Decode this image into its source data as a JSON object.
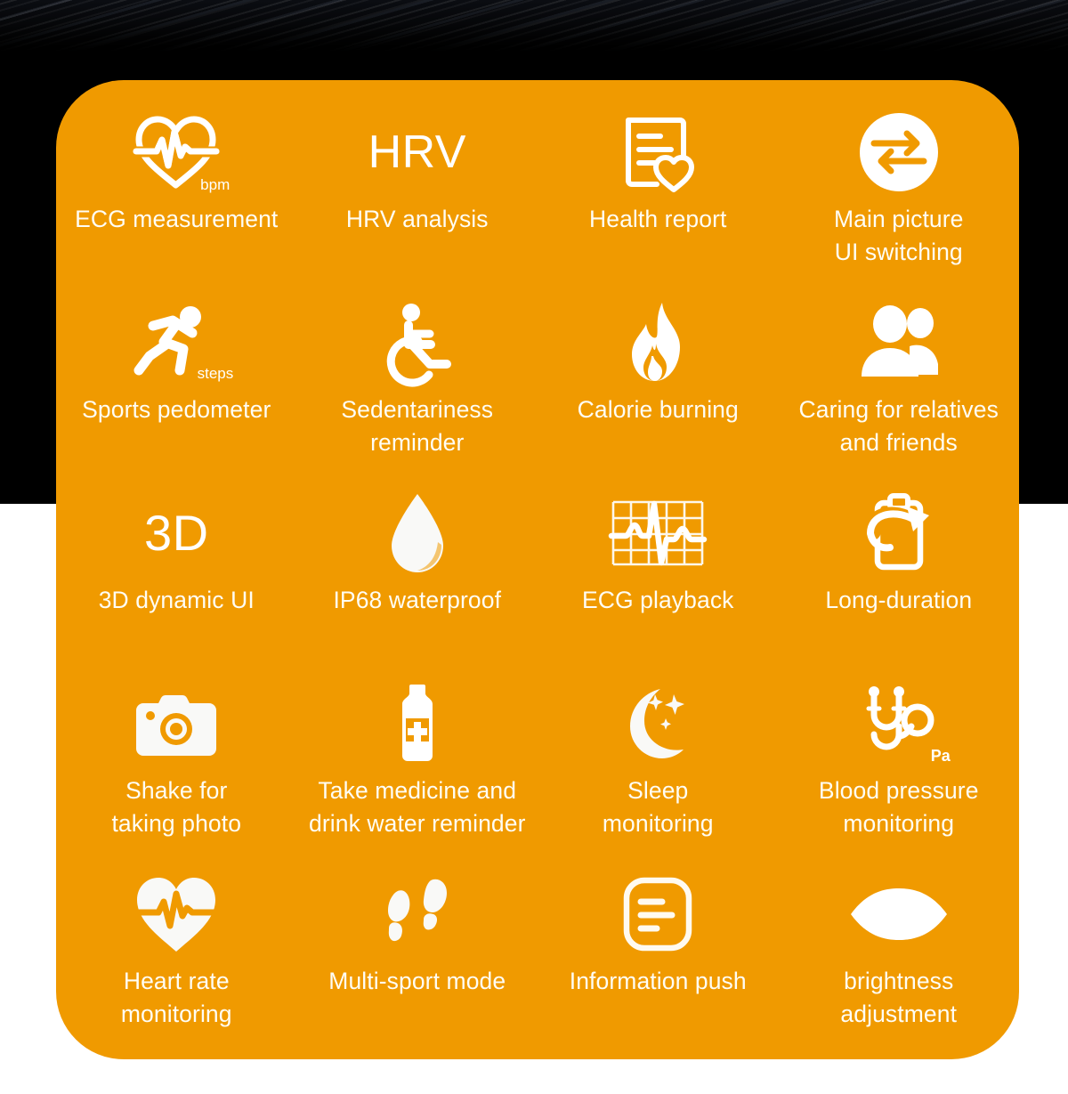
{
  "theme": {
    "card_color": "#f09a00",
    "icon_color": "#ffffff",
    "label_color": "#fffdf4",
    "backdrop_top_color": "#000000",
    "backdrop_bottom_color": "#ffffff"
  },
  "features": [
    {
      "icon": "heart-ecg-outline-icon",
      "caption": "bpm",
      "label": "ECG measurement"
    },
    {
      "icon": "hrv-text-icon",
      "glyph_text": "HRV",
      "label": "HRV analysis"
    },
    {
      "icon": "document-heart-icon",
      "label": "Health report"
    },
    {
      "icon": "swap-arrows-circle-icon",
      "label": "Main picture\nUI switching"
    },
    {
      "icon": "running-person-icon",
      "caption": "steps",
      "label": "Sports pedometer"
    },
    {
      "icon": "wheelchair-icon",
      "label": "Sedentariness\nreminder"
    },
    {
      "icon": "flame-icon",
      "label": "Calorie burning"
    },
    {
      "icon": "two-people-icon",
      "label": "Caring for relatives\nand friends"
    },
    {
      "icon": "three-d-text-icon",
      "glyph_text": "3D",
      "label": "3D dynamic UI"
    },
    {
      "icon": "water-droplet-icon",
      "label": "IP68 waterproof"
    },
    {
      "icon": "ecg-grid-waveform-icon",
      "label": "ECG playback"
    },
    {
      "icon": "clipboard-refresh-arrow-icon",
      "label": "Long-duration"
    },
    {
      "icon": "camera-icon",
      "label": "Shake for\ntaking photo"
    },
    {
      "icon": "medicine-bottle-icon",
      "label": "Take medicine and\ndrink water reminder"
    },
    {
      "icon": "crescent-moon-stars-icon",
      "label": "Sleep\nmonitoring"
    },
    {
      "icon": "stethoscope-icon",
      "caption": "Pa",
      "label": "Blood pressure\nmonitoring"
    },
    {
      "icon": "heart-pulse-filled-icon",
      "label": "Heart rate\nmonitoring"
    },
    {
      "icon": "footprints-icon",
      "label": "Multi-sport mode"
    },
    {
      "icon": "message-lines-rounded-icon",
      "label": "Information push"
    },
    {
      "icon": "eye-icon",
      "label": "brightness\nadjustment"
    }
  ]
}
